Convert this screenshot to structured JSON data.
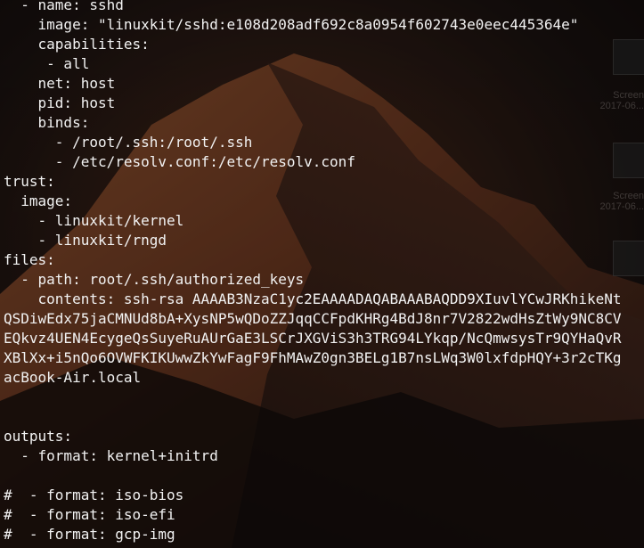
{
  "desktop": {
    "items": [
      {
        "label1": "Screen",
        "label2": "2017-06..."
      },
      {
        "label1": "Screen",
        "label2": "2017-06..."
      }
    ]
  },
  "terminal": {
    "lines": [
      "  - name: sshd",
      "    image: \"linuxkit/sshd:e108d208adf692c8a0954f602743e0eec445364e\"",
      "    capabilities:",
      "     - all",
      "    net: host",
      "    pid: host",
      "    binds:",
      "      - /root/.ssh:/root/.ssh",
      "      - /etc/resolv.conf:/etc/resolv.conf",
      "trust:",
      "  image:",
      "    - linuxkit/kernel",
      "    - linuxkit/rngd",
      "files:",
      "  - path: root/.ssh/authorized_keys",
      "    contents: ssh-rsa AAAAB3NzaC1yc2EAAAADAQABAAABAQDD9XIuvlYCwJRKhikeNt",
      "QSDiwEdx75jaCMNUd8bA+XysNP5wQDoZZJqqCCFpdKHRg4BdJ8nr7V2822wdHsZtWy9NC8CV",
      "EQkvz4UEN4EcygeQsSuyeRuAUrGaE3LSCrJXGViS3h3TRG94LYkqp/NcQmwsysTr9QYHaQvR",
      "XBlXx+i5nQo6OVWFKIKUwwZkYwFagF9FhMAwZ0gn3BELg1B7nsLWq3W0lxfdpHQY+3r2cTKg",
      "acBook-Air.local",
      "",
      "",
      "outputs:",
      "  - format: kernel+initrd",
      "",
      "#  - format: iso-bios",
      "#  - format: iso-efi",
      "#  - format: gcp-img"
    ]
  }
}
